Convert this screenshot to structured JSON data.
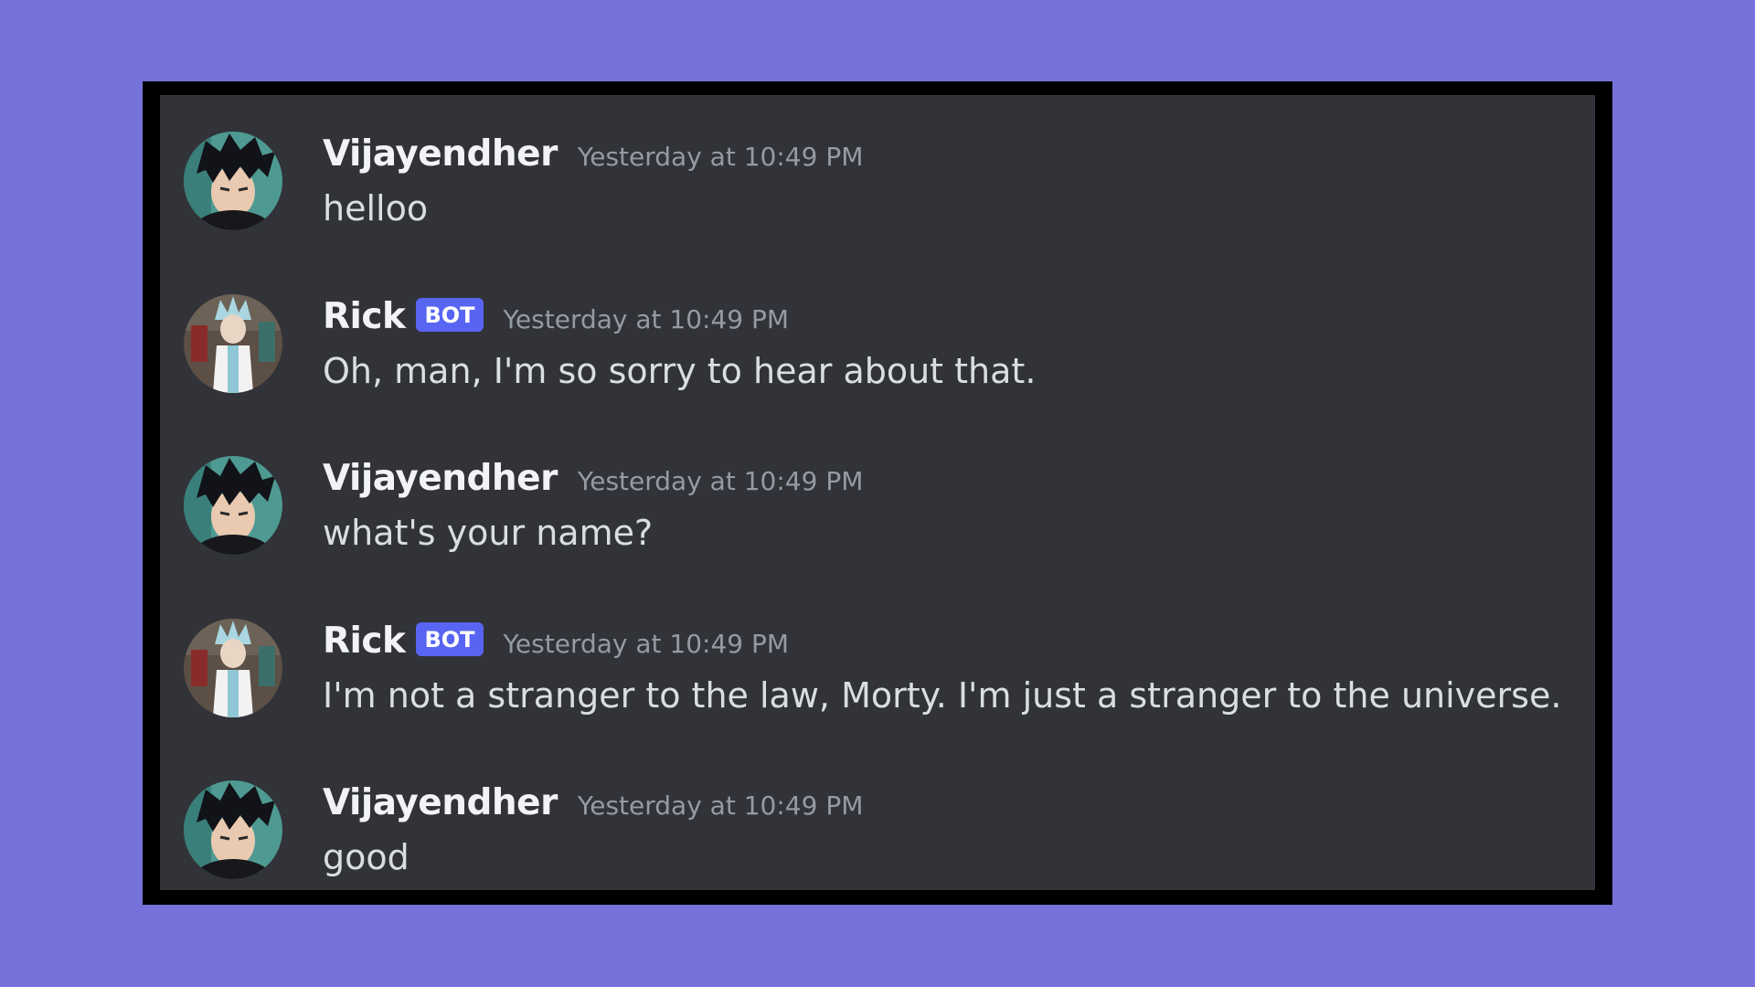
{
  "messages": [
    {
      "author": "Vijayendher",
      "is_bot": false,
      "timestamp": "Yesterday at 10:49 PM",
      "content": "helloo",
      "avatar": "anime-boy-avatar"
    },
    {
      "author": "Rick",
      "is_bot": true,
      "badge": "BOT",
      "timestamp": "Yesterday at 10:49 PM",
      "content": "Oh, man, I'm so sorry to hear about that.",
      "avatar": "rick-avatar"
    },
    {
      "author": "Vijayendher",
      "is_bot": false,
      "timestamp": "Yesterday at 10:49 PM",
      "content": "what's your name?",
      "avatar": "anime-boy-avatar"
    },
    {
      "author": "Rick",
      "is_bot": true,
      "badge": "BOT",
      "timestamp": "Yesterday at 10:49 PM",
      "content": "I'm not a stranger to the law, Morty. I'm just a stranger to the universe.",
      "avatar": "rick-avatar"
    },
    {
      "author": "Vijayendher",
      "is_bot": false,
      "timestamp": "Yesterday at 10:49 PM",
      "content": "good",
      "avatar": "anime-boy-avatar"
    }
  ],
  "colors": {
    "page_background": "#7672db",
    "chat_background": "#313338",
    "bot_badge": "#5865f2",
    "username": "#f2f3f5",
    "timestamp": "#949ba4",
    "message_text": "#dbdee1"
  }
}
